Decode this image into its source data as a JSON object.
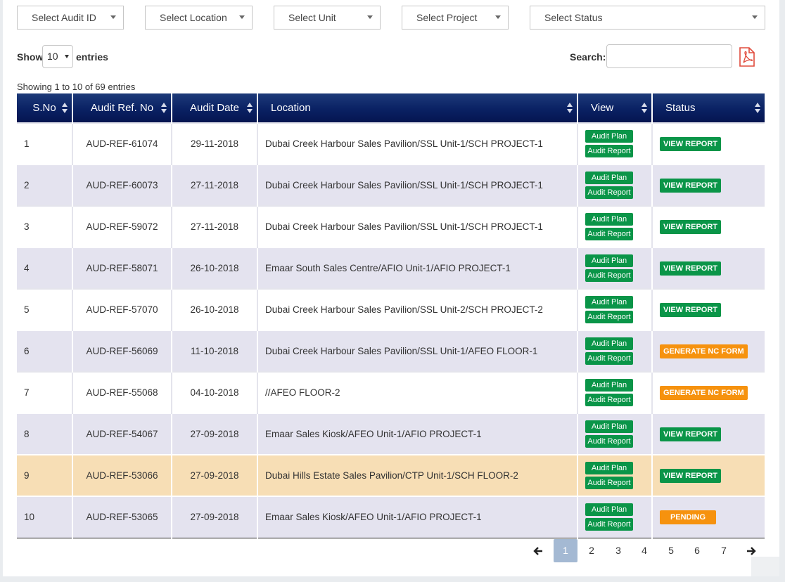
{
  "filters": {
    "audit_id": "Select Audit ID",
    "location": "Select Location",
    "unit": "Select Unit",
    "project": "Select Project",
    "status": "Select Status"
  },
  "length": {
    "show": "Show",
    "value": "10",
    "entries": "entries"
  },
  "search": {
    "label": "Search:",
    "value": ""
  },
  "info": "Showing 1 to 10 of 69 entries",
  "table": {
    "headers": [
      "S.No",
      "Audit Ref. No",
      "Audit Date",
      "Location",
      "View",
      "Status"
    ],
    "view_buttons": {
      "plan": "Audit Plan",
      "report": "Audit Report"
    },
    "rows": [
      {
        "sno": "1",
        "ref": "AUD-REF-61074",
        "date": "29-11-2018",
        "location": "Dubai Creek Harbour Sales Pavilion/SSL Unit-1/SCH PROJECT-1",
        "status": "VIEW REPORT"
      },
      {
        "sno": "2",
        "ref": "AUD-REF-60073",
        "date": "27-11-2018",
        "location": "Dubai Creek Harbour Sales Pavilion/SSL Unit-1/SCH PROJECT-1",
        "status": "VIEW REPORT"
      },
      {
        "sno": "3",
        "ref": "AUD-REF-59072",
        "date": "27-11-2018",
        "location": "Dubai Creek Harbour Sales Pavilion/SSL Unit-1/SCH PROJECT-1",
        "status": "VIEW REPORT"
      },
      {
        "sno": "4",
        "ref": "AUD-REF-58071",
        "date": "26-10-2018",
        "location": "Emaar South Sales Centre/AFIO Unit-1/AFIO PROJECT-1",
        "status": "VIEW REPORT"
      },
      {
        "sno": "5",
        "ref": "AUD-REF-57070",
        "date": "26-10-2018",
        "location": "Dubai Creek Harbour Sales Pavilion/SSL Unit-2/SCH PROJECT-2",
        "status": "VIEW REPORT"
      },
      {
        "sno": "6",
        "ref": "AUD-REF-56069",
        "date": "11-10-2018",
        "location": "Dubai Creek Harbour Sales Pavilion/SSL Unit-1/AFEO FLOOR-1",
        "status": "GENERATE NC FORM"
      },
      {
        "sno": "7",
        "ref": "AUD-REF-55068",
        "date": "04-10-2018",
        "location": "//AFEO FLOOR-2",
        "status": "GENERATE NC FORM"
      },
      {
        "sno": "8",
        "ref": "AUD-REF-54067",
        "date": "27-09-2018",
        "location": "Emaar Sales Kiosk/AFEO Unit-1/AFIO PROJECT-1",
        "status": "VIEW REPORT"
      },
      {
        "sno": "9",
        "ref": "AUD-REF-53066",
        "date": "27-09-2018",
        "location": "Dubai Hills Estate Sales Pavilion/CTP Unit-1/SCH FLOOR-2",
        "status": "VIEW REPORT"
      },
      {
        "sno": "10",
        "ref": "AUD-REF-53065",
        "date": "27-09-2018",
        "location": "Emaar Sales Kiosk/AFEO Unit-1/AFIO PROJECT-1",
        "status": "PENDING"
      }
    ]
  },
  "pagination": {
    "pages": [
      "1",
      "2",
      "3",
      "4",
      "5",
      "6",
      "7"
    ],
    "active": "1"
  },
  "colors": {
    "header": "#0a2163",
    "green": "#0a9548",
    "orange": "#f6920e",
    "highlight_row": "#f7deb5",
    "active_page": "#a4b9d3"
  },
  "icons": {
    "pdf": "pdf-icon",
    "prev": "arrow-left-icon",
    "next": "arrow-right-icon"
  }
}
